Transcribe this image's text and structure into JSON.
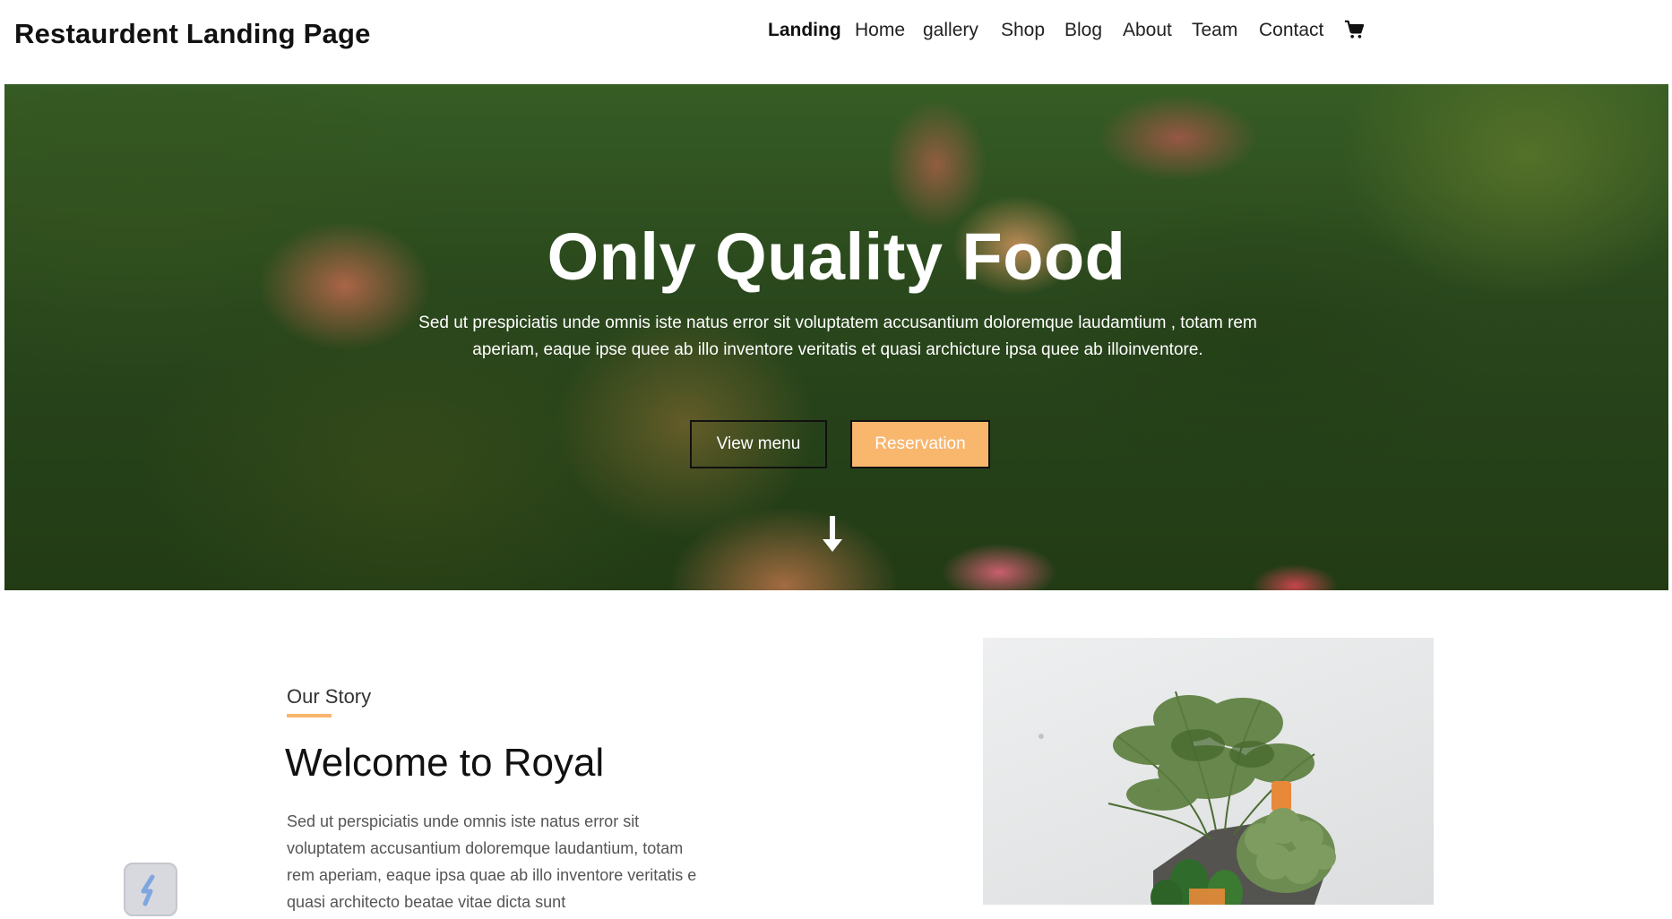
{
  "brand": "Restaurdent Landing Page",
  "nav": {
    "items": [
      {
        "label": "Landing",
        "active": true
      },
      {
        "label": "Home"
      },
      {
        "label": "gallery"
      },
      {
        "label": "Shop"
      },
      {
        "label": "Blog"
      },
      {
        "label": "About"
      },
      {
        "label": "Team"
      },
      {
        "label": "Contact"
      }
    ],
    "cart_icon": "shopping-cart-icon"
  },
  "hero": {
    "title": "Only Quality Food",
    "text": "Sed ut prespiciatis unde omnis iste natus error sit voluptatem accusantium doloremque laudamtium , totam rem aperiam, eaque ipse quee ab illo inventore veritatis et quasi archicture ipsa quee ab illoinventore.",
    "buttons": {
      "view_menu": "View menu",
      "reservation": "Reservation"
    },
    "scroll_icon": "arrow-down-icon"
  },
  "story": {
    "eyebrow": "Our Story",
    "title": "Welcome to Royal",
    "text": "Sed ut perspiciatis unde omnis iste natus error sit voluptatem accusantium doloremque laudantium, totam rem aperiam, eaque ipsa quae ab illo inventore veritatis e quasi architecto beatae vitae dicta sunt"
  },
  "colors": {
    "accent": "#f9b66d",
    "text_dark": "#111111",
    "text_muted": "#555555"
  }
}
